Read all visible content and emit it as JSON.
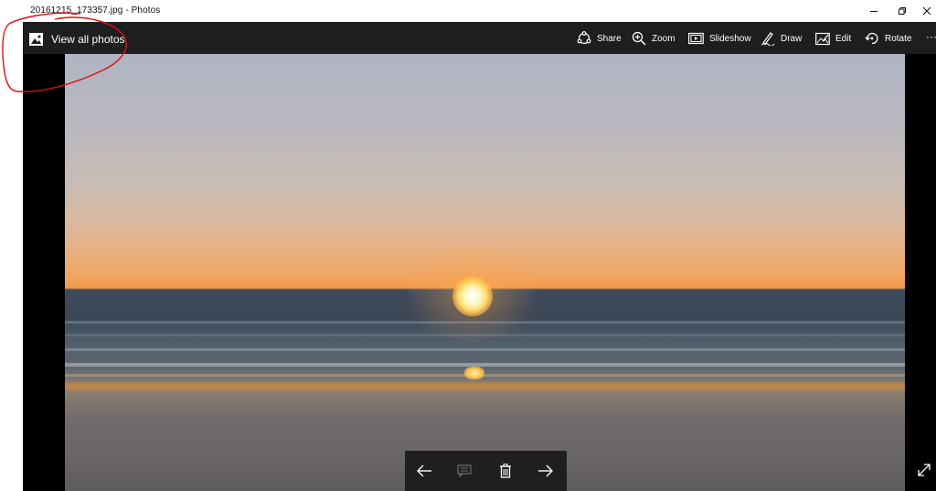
{
  "window": {
    "title": "20161215_173357.jpg - Photos"
  },
  "toolbar": {
    "view_all": "View all photos",
    "share": "Share",
    "zoom": "Zoom",
    "slideshow": "Slideshow",
    "draw": "Draw",
    "edit": "Edit",
    "rotate": "Rotate",
    "more": "···"
  },
  "controls": [
    "arrow-left-icon",
    "comment-icon",
    "trash-icon",
    "arrow-right-icon"
  ],
  "icons": {
    "view_all": "photos-icon",
    "share": "share-icon",
    "zoom": "zoom-icon",
    "slideshow": "slideshow-icon",
    "draw": "draw-icon",
    "edit": "edit-icon",
    "rotate": "rotate-icon",
    "expand": "expand-icon"
  },
  "colors": {
    "toolbar_bg": "#1e1e1e",
    "app_bg": "#000000",
    "annotation": "#e01010"
  }
}
